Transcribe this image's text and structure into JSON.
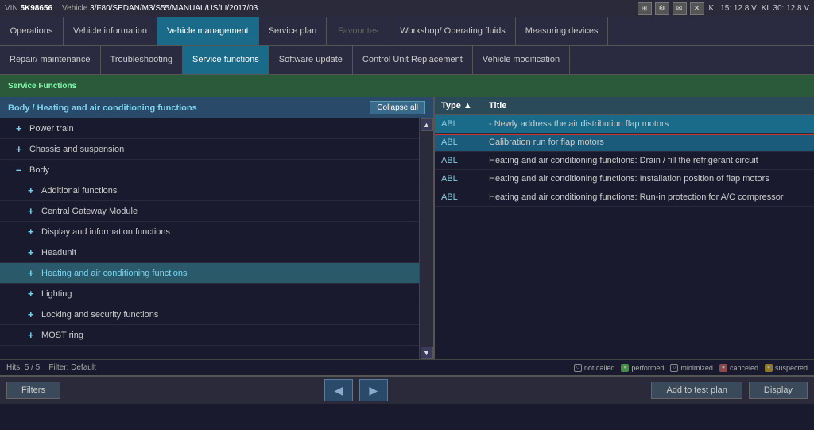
{
  "topbar": {
    "vin_label": "VIN",
    "vin_value": "5K98656",
    "vehicle_label": "Vehicle",
    "vehicle_value": "3/F80/SEDAN/M3/S55/MANUAL/US/LI/2017/03",
    "kl15": "KL 15:  12.8 V",
    "kl30": "KL 30:  12.8 V"
  },
  "nav_row1": {
    "items": [
      {
        "label": "Operations",
        "active": false
      },
      {
        "label": "Vehicle information",
        "active": false
      },
      {
        "label": "Vehicle management",
        "active": true
      },
      {
        "label": "Service plan",
        "active": false
      },
      {
        "label": "Favourites",
        "active": false
      },
      {
        "label": "Workshop/ Operating fluids",
        "active": false
      },
      {
        "label": "Measuring devices",
        "active": false
      }
    ]
  },
  "nav_row2": {
    "items": [
      {
        "label": "Repair/ maintenance",
        "active": false
      },
      {
        "label": "Troubleshooting",
        "active": false
      },
      {
        "label": "Service functions",
        "active": true
      },
      {
        "label": "Software update",
        "active": false
      },
      {
        "label": "Control Unit Replacement",
        "active": false
      },
      {
        "label": "Vehicle modification",
        "active": false
      }
    ]
  },
  "service_tab": {
    "label": "Service Functions"
  },
  "left_panel": {
    "header": "Body / Heating and air conditioning functions",
    "collapse_btn": "Collapse all",
    "tree": [
      {
        "level": 1,
        "icon": "+",
        "label": "Power train",
        "selected": false
      },
      {
        "level": 1,
        "icon": "+",
        "label": "Chassis and suspension",
        "selected": false
      },
      {
        "level": 1,
        "icon": "–",
        "label": "Body",
        "selected": false
      },
      {
        "level": 2,
        "icon": "+",
        "label": "Additional functions",
        "selected": false
      },
      {
        "level": 2,
        "icon": "+",
        "label": "Central Gateway Module",
        "selected": false
      },
      {
        "level": 2,
        "icon": "+",
        "label": "Display and information functions",
        "selected": false
      },
      {
        "level": 2,
        "icon": "+",
        "label": "Headunit",
        "selected": false
      },
      {
        "level": 2,
        "icon": "+",
        "label": "Heating and air conditioning functions",
        "selected": true
      },
      {
        "level": 2,
        "icon": "+",
        "label": "Lighting",
        "selected": false
      },
      {
        "level": 2,
        "icon": "+",
        "label": "Locking and security functions",
        "selected": false
      },
      {
        "level": 2,
        "icon": "+",
        "label": "MOST ring",
        "selected": false
      }
    ]
  },
  "right_panel": {
    "col_type": "Type ▲",
    "col_title": "Title",
    "rows": [
      {
        "type": "ABL",
        "title": "- Newly address the air distribution flap motors",
        "highlighted": true,
        "selected": true
      },
      {
        "type": "ABL",
        "title": "Calibration run for flap motors",
        "highlighted": true,
        "selected": false
      },
      {
        "type": "ABL",
        "title": "Heating and air conditioning functions: Drain / fill the refrigerant circuit",
        "highlighted": false,
        "selected": false
      },
      {
        "type": "ABL",
        "title": "Heating and air conditioning functions: Installation position of flap motors",
        "highlighted": false,
        "selected": false
      },
      {
        "type": "ABL",
        "title": "Heating and air conditioning functions: Run-in protection for A/C compressor",
        "highlighted": false,
        "selected": false
      }
    ]
  },
  "status_bar": {
    "hits": "Hits: 5 / 5",
    "filter": "Filter: Default",
    "legend": [
      {
        "symbol": "○",
        "label": "not called"
      },
      {
        "symbol": "●",
        "label": "performed"
      },
      {
        "symbol": "○",
        "label": "minimized"
      },
      {
        "symbol": "●",
        "label": "canceled"
      },
      {
        "symbol": "●",
        "label": "suspected"
      }
    ]
  },
  "bottom_bar": {
    "filters_btn": "Filters",
    "add_btn": "Add to test plan",
    "display_btn": "Display"
  }
}
